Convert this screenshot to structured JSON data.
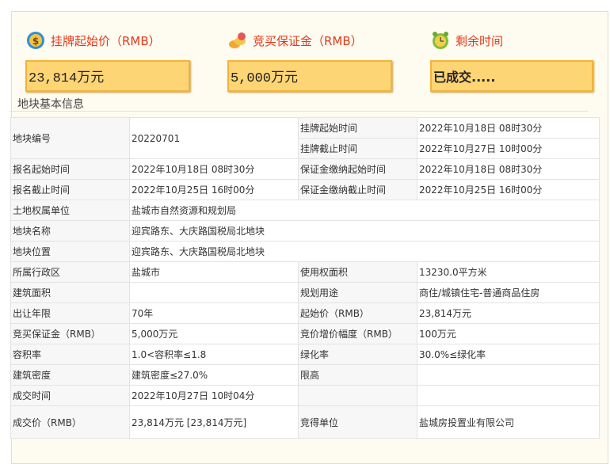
{
  "header": {
    "start_price": {
      "title": "挂牌起始价（RMB）",
      "value": "23,814万元",
      "icon": "money-icon"
    },
    "deposit": {
      "title": "竞买保证金（RMB）",
      "value": "5,000万元",
      "icon": "coins-icon"
    },
    "time_left": {
      "title": "剩余时间",
      "value": "已成交.....",
      "icon": "alarm-clock-icon"
    }
  },
  "section_title": "地块基本信息",
  "info": {
    "parcel_no_label": "地块编号",
    "parcel_no": "20220701",
    "listing_start_label": "挂牌起始时间",
    "listing_start": "2022年10月18日 08时30分",
    "listing_end_label": "挂牌截止时间",
    "listing_end": "2022年10月27日 10时00分",
    "signup_start_label": "报名起始时间",
    "signup_start": "2022年10月18日 08时30分",
    "deposit_start_label": "保证金缴纳起始时间",
    "deposit_start": "2022年10月18日 08时30分",
    "signup_end_label": "报名截止时间",
    "signup_end": "2022年10月25日 16时00分",
    "deposit_end_label": "保证金缴纳截止时间",
    "deposit_end": "2022年10月25日 16时00分",
    "owner_label": "土地权属单位",
    "owner": "盐城市自然资源和规划局",
    "name_label": "地块名称",
    "name": "迎宾路东、大庆路国税局北地块",
    "location_label": "地块位置",
    "location": "迎宾路东、大庆路国税局北地块",
    "district_label": "所属行政区",
    "district": "盐城市",
    "use_area_label": "使用权面积",
    "use_area": "13230.0平方米",
    "build_area_label": "建筑面积",
    "build_area": "",
    "plan_use_label": "规划用途",
    "plan_use": "商住/城镇住宅-普通商品住房",
    "term_label": "出让年限",
    "term": "70年",
    "start_price_label": "起始价（RMB）",
    "start_price": "23,814万元",
    "deposit_label": "竞买保证金（RMB）",
    "deposit": "5,000万元",
    "increment_label": "竞价增价幅度（RMB）",
    "increment": "100万元",
    "far_label": "容积率",
    "far": "1.0<容积率≤1.8",
    "green_label": "绿化率",
    "green": "30.0%≤绿化率",
    "density_label": "建筑密度",
    "density": "建筑密度≤27.0%",
    "height_label": "限高",
    "height": "",
    "deal_time_label": "成交时间",
    "deal_time": "2022年10月27日 10时04分",
    "deal_price_label": "成交价（RMB）",
    "deal_price": "23,814万元 [23,814万元]",
    "winner_label": "竞得单位",
    "winner": "盐城房投置业有限公司"
  }
}
